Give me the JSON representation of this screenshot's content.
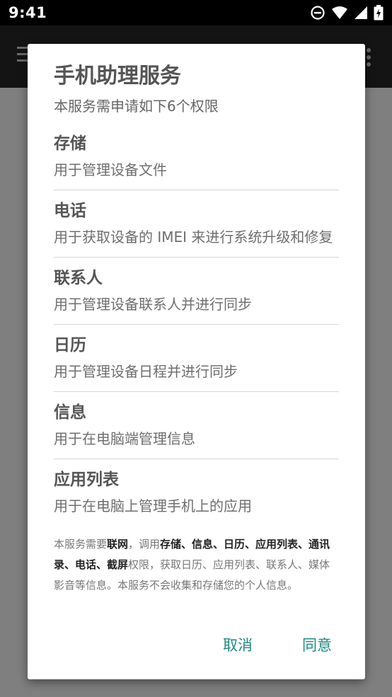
{
  "status_bar": {
    "time": "9:41",
    "icons": [
      "do-not-disturb-icon",
      "wifi-icon",
      "signal-icon",
      "battery-icon"
    ]
  },
  "dialog": {
    "title": "手机助理服务",
    "subtitle": "本服务需申请如下6个权限",
    "permissions": [
      {
        "name": "存储",
        "description": "用于管理设备文件"
      },
      {
        "name": "电话",
        "description": "用于获取设备的 IMEI 来进行系统升级和修复"
      },
      {
        "name": "联系人",
        "description": "用于管理设备联系人并进行同步"
      },
      {
        "name": "日历",
        "description": "用于管理设备日程并进行同步"
      },
      {
        "name": "信息",
        "description": "用于在电脑端管理信息"
      },
      {
        "name": "应用列表",
        "description": "用于在电脑上管理手机上的应用"
      }
    ],
    "notice": {
      "part1": "本服务需要",
      "bold1": "联网",
      "part2": "，调用",
      "bold2": "存储、信息、日历、应用列表、通讯录、电话、截屏",
      "part3": "权限，获取日历、应用列表、联系人、媒体影音等信息。本服务不会收集和存储您的个人信息。"
    },
    "cancel_label": "取消",
    "agree_label": "同意"
  },
  "colors": {
    "accent": "#1f8a80",
    "scrim": "#7f7f7f",
    "status_bar": "#000000"
  }
}
